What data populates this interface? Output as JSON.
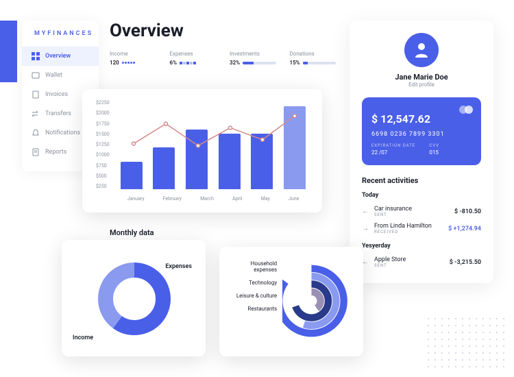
{
  "brand": "MYFINANCES",
  "sidebar": {
    "items": [
      {
        "label": "Overview",
        "icon": "grid-icon"
      },
      {
        "label": "Wallet",
        "icon": "wallet-icon"
      },
      {
        "label": "Invoices",
        "icon": "invoice-icon",
        "expandable": true
      },
      {
        "label": "Transfers",
        "icon": "transfers-icon",
        "expandable": true
      },
      {
        "label": "Notifications",
        "icon": "bell-icon"
      },
      {
        "label": "Reports",
        "icon": "reports-icon"
      }
    ]
  },
  "page": {
    "title": "Overview"
  },
  "metrics": {
    "income": {
      "label": "Income",
      "value": "120"
    },
    "expenses": {
      "label": "Expenses",
      "value": "6%"
    },
    "investments": {
      "label": "Investments",
      "value": "32%"
    },
    "donations": {
      "label": "Donations",
      "value": "15%"
    }
  },
  "chart_data": [
    {
      "type": "bar",
      "categories": [
        "January",
        "February",
        "March",
        "April",
        "May",
        "June"
      ],
      "values": [
        700,
        1050,
        1500,
        1400,
        1400,
        2100
      ],
      "ylim": [
        0,
        2250
      ],
      "yticks": [
        "$2250",
        "$2000",
        "$1750",
        "$1500",
        "$1250",
        "$1000",
        "$750",
        "$500",
        "$250"
      ],
      "line_values": [
        1150,
        1650,
        1100,
        1550,
        1250,
        1850
      ]
    },
    {
      "type": "pie",
      "series": [
        {
          "name": "Expenses",
          "value": 40
        },
        {
          "name": "Income",
          "value": 60
        }
      ],
      "title": "Monthly data"
    },
    {
      "type": "radial",
      "series": [
        {
          "name": "Household expenses",
          "value": 85,
          "color": "#4a5fe8"
        },
        {
          "name": "Technology",
          "value": 55,
          "color": "#6b7fd7"
        },
        {
          "name": "Leisure & culture",
          "value": 70,
          "color": "#2a3a8a"
        },
        {
          "name": "Restaurants",
          "value": 40,
          "color": "#9a8fb5"
        }
      ]
    }
  ],
  "monthly": {
    "title": "Monthly data",
    "labels": {
      "expenses": "Expenses",
      "income": "Income"
    }
  },
  "radial": {
    "labels": [
      "Household expenses",
      "Technology",
      "Leisure & culture",
      "Restaurants"
    ]
  },
  "profile": {
    "name": "Jane Marie Doe",
    "edit": "Edit profile"
  },
  "card": {
    "balance": "$ 12,547.62",
    "number": "6698 0236 7899 3301",
    "exp_label": "EXPIRATION DATE",
    "exp": "22 /07",
    "cvv_label": "CVV",
    "cvv": "015"
  },
  "recent": {
    "title": "Recent activities",
    "groups": [
      {
        "label": "Today",
        "items": [
          {
            "title": "Car insurance",
            "sub": "SENT",
            "amount": "$ -810.50",
            "dir": "out"
          },
          {
            "title": "From Linda Hamilton",
            "sub": "RECEIVED",
            "amount": "$ +1,274.94",
            "dir": "in"
          }
        ]
      },
      {
        "label": "Yesyerday",
        "items": [
          {
            "title": "Apple Store",
            "sub": "SENT",
            "amount": "$ -3,215.50",
            "dir": "out"
          }
        ]
      }
    ]
  }
}
